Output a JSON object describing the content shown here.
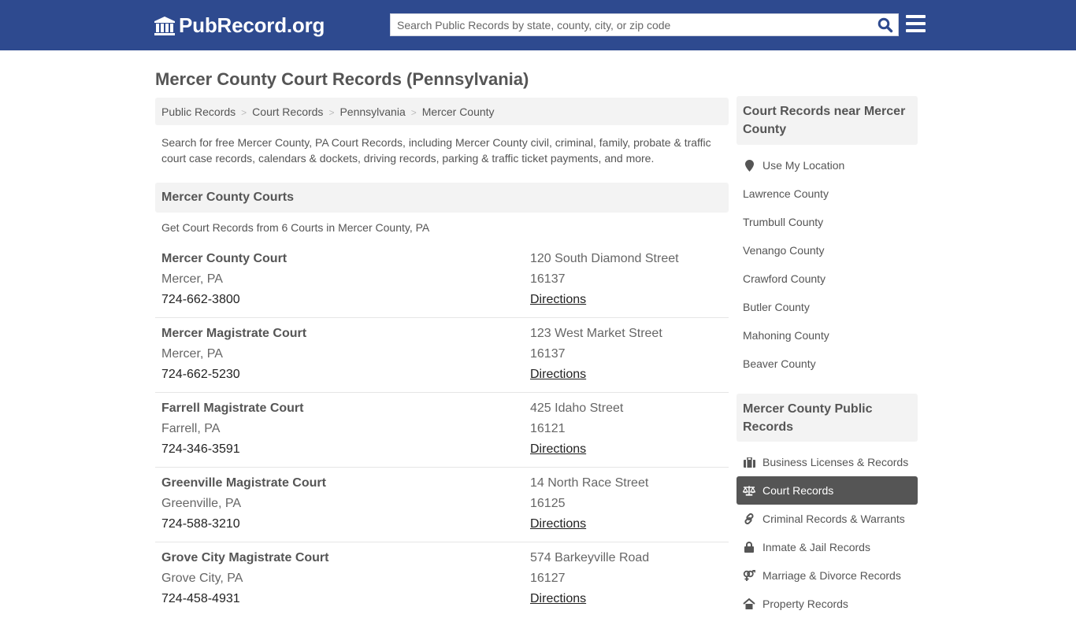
{
  "header": {
    "logo_text": "PubRecord.org",
    "search_placeholder": "Search Public Records by state, county, city, or zip code",
    "search_value": ""
  },
  "page": {
    "title": "Mercer County Court Records (Pennsylvania)",
    "breadcrumb": [
      "Public Records",
      "Court Records",
      "Pennsylvania",
      "Mercer County"
    ],
    "breadcrumb_separator": ">",
    "intro": "Search for free Mercer County, PA Court Records, including Mercer County civil, criminal, family, probate & traffic court case records, calendars & dockets, driving records, parking & traffic ticket payments, and more."
  },
  "courts_section": {
    "heading": "Mercer County Courts",
    "subheading": "Get Court Records from 6 Courts in Mercer County, PA",
    "directions_label": "Directions",
    "courts": [
      {
        "name": "Mercer County Court",
        "city": "Mercer, PA",
        "phone": "724-662-3800",
        "address": "120 South Diamond Street",
        "zip": "16137"
      },
      {
        "name": "Mercer Magistrate Court",
        "city": "Mercer, PA",
        "phone": "724-662-5230",
        "address": "123 West Market Street",
        "zip": "16137"
      },
      {
        "name": "Farrell Magistrate Court",
        "city": "Farrell, PA",
        "phone": "724-346-3591",
        "address": "425 Idaho Street",
        "zip": "16121"
      },
      {
        "name": "Greenville Magistrate Court",
        "city": "Greenville, PA",
        "phone": "724-588-3210",
        "address": "14 North Race Street",
        "zip": "16125"
      },
      {
        "name": "Grove City Magistrate Court",
        "city": "Grove City, PA",
        "phone": "724-458-4931",
        "address": "574 Barkeyville Road",
        "zip": "16127"
      }
    ]
  },
  "sidebar": {
    "nearby": {
      "heading": "Court Records near Mercer County",
      "use_location": "Use My Location",
      "counties": [
        "Lawrence County",
        "Trumbull County",
        "Venango County",
        "Crawford County",
        "Butler County",
        "Mahoning County",
        "Beaver County"
      ]
    },
    "public_records": {
      "heading": "Mercer County Public Records",
      "items": [
        {
          "label": "Business Licenses & Records",
          "icon": "briefcase-icon",
          "active": false
        },
        {
          "label": "Court Records",
          "icon": "scales-icon",
          "active": true
        },
        {
          "label": "Criminal Records & Warrants",
          "icon": "link-icon",
          "active": false
        },
        {
          "label": "Inmate & Jail Records",
          "icon": "lock-icon",
          "active": false
        },
        {
          "label": "Marriage & Divorce Records",
          "icon": "venus-mars-icon",
          "active": false
        },
        {
          "label": "Property Records",
          "icon": "home-icon",
          "active": false
        }
      ]
    }
  },
  "colors": {
    "header_bg": "#2e4a8f",
    "search_icon": "#2e4a8f",
    "panel_bg": "#f3f3f3",
    "active_item_bg": "#555555"
  }
}
